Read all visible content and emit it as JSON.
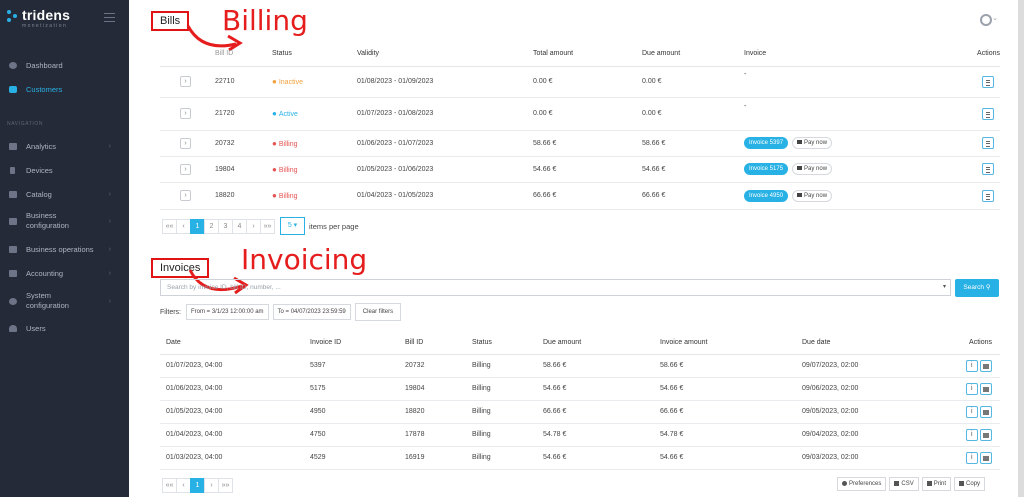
{
  "brand": {
    "name": "tridens",
    "tagline": "monetization"
  },
  "sidebar": {
    "top_items": [
      {
        "label": "Dashboard",
        "icon": "dashboard-icon"
      },
      {
        "label": "Customers",
        "icon": "users-icon"
      }
    ],
    "section_label": "NAVIGATION",
    "nav_items": [
      {
        "label": "Analytics",
        "icon": "chart-icon"
      },
      {
        "label": "Devices",
        "icon": "device-icon"
      },
      {
        "label": "Catalog",
        "icon": "tag-icon"
      },
      {
        "label": "Business configuration",
        "icon": "cogs-icon"
      },
      {
        "label": "Business operations",
        "icon": "handshake-icon"
      },
      {
        "label": "Accounting",
        "icon": "money-icon"
      },
      {
        "label": "System configuration",
        "icon": "gear-icon"
      },
      {
        "label": "Users",
        "icon": "user-icon"
      }
    ]
  },
  "annotations": {
    "billing": "Billing",
    "invoicing": "Invoicing"
  },
  "bills": {
    "label": "Bills",
    "columns": [
      "Bill ID",
      "Status",
      "Validity",
      "Total amount",
      "Due amount",
      "Invoice",
      "Actions"
    ],
    "rows": [
      {
        "id": "22710",
        "status": "Inactive",
        "validity": "01/08/2023 - 01/09/2023",
        "total": "0.00 €",
        "due": "0.00 €",
        "invoice": "-",
        "pay": ""
      },
      {
        "id": "21720",
        "status": "Active",
        "validity": "01/07/2023 - 01/08/2023",
        "total": "0.00 €",
        "due": "0.00 €",
        "invoice": "-",
        "pay": ""
      },
      {
        "id": "20732",
        "status": "Billing",
        "validity": "01/06/2023 - 01/07/2023",
        "total": "58.66 €",
        "due": "58.66 €",
        "invoice": "Invoice 5397",
        "pay": "Pay now"
      },
      {
        "id": "19804",
        "status": "Billing",
        "validity": "01/05/2023 - 01/06/2023",
        "total": "54.66 €",
        "due": "54.66 €",
        "invoice": "Invoice 5175",
        "pay": "Pay now"
      },
      {
        "id": "18820",
        "status": "Billing",
        "validity": "01/04/2023 - 01/05/2023",
        "total": "66.66 €",
        "due": "66.66 €",
        "invoice": "Invoice 4950",
        "pay": "Pay now"
      }
    ],
    "pager": {
      "first": "««",
      "prev": "‹",
      "pages": [
        "1",
        "2",
        "3",
        "4"
      ],
      "next": "›",
      "last": "»»",
      "per_page": "5 ▾",
      "per_page_label": "items per page"
    }
  },
  "invoices": {
    "label": "Invoices",
    "search_placeholder": "Search by invoice ID, bill ID, number, ...",
    "search_button": "Search",
    "filters_label": "Filters:",
    "filters": [
      "From = 3/1/23 12:00:00 am",
      "To = 04/07/2023 23:59:59"
    ],
    "clear_filters": "Clear filters",
    "columns": [
      "Date",
      "Invoice ID",
      "Bill ID",
      "Status",
      "Due amount",
      "Invoice amount",
      "Due date",
      "Actions"
    ],
    "rows": [
      {
        "date": "01/07/2023, 04:00",
        "invoice_id": "5397",
        "bill_id": "20732",
        "status": "Billing",
        "due": "58.66 €",
        "amount": "58.66 €",
        "due_date": "09/07/2023, 02:00"
      },
      {
        "date": "01/06/2023, 04:00",
        "invoice_id": "5175",
        "bill_id": "19804",
        "status": "Billing",
        "due": "54.66 €",
        "amount": "54.66 €",
        "due_date": "09/06/2023, 02:00"
      },
      {
        "date": "01/05/2023, 04:00",
        "invoice_id": "4950",
        "bill_id": "18820",
        "status": "Billing",
        "due": "66.66 €",
        "amount": "66.66 €",
        "due_date": "09/05/2023, 02:00"
      },
      {
        "date": "01/04/2023, 04:00",
        "invoice_id": "4750",
        "bill_id": "17878",
        "status": "Billing",
        "due": "54.78 €",
        "amount": "54.78 €",
        "due_date": "09/04/2023, 02:00"
      },
      {
        "date": "01/03/2023, 04:00",
        "invoice_id": "4529",
        "bill_id": "16919",
        "status": "Billing",
        "due": "54.66 €",
        "amount": "54.66 €",
        "due_date": "09/03/2023, 02:00"
      }
    ],
    "pager": {
      "first": "««",
      "prev": "‹",
      "pages": [
        "1"
      ],
      "next": "›",
      "last": "»»"
    },
    "tools": [
      "Preferences",
      "CSV",
      "Print",
      "Copy"
    ]
  },
  "colors": {
    "accent": "#28b1e4",
    "sidebar_bg": "#252a38",
    "annotation": "#e51d1d",
    "inactive": "#f0a03c",
    "billing": "#e55353"
  }
}
